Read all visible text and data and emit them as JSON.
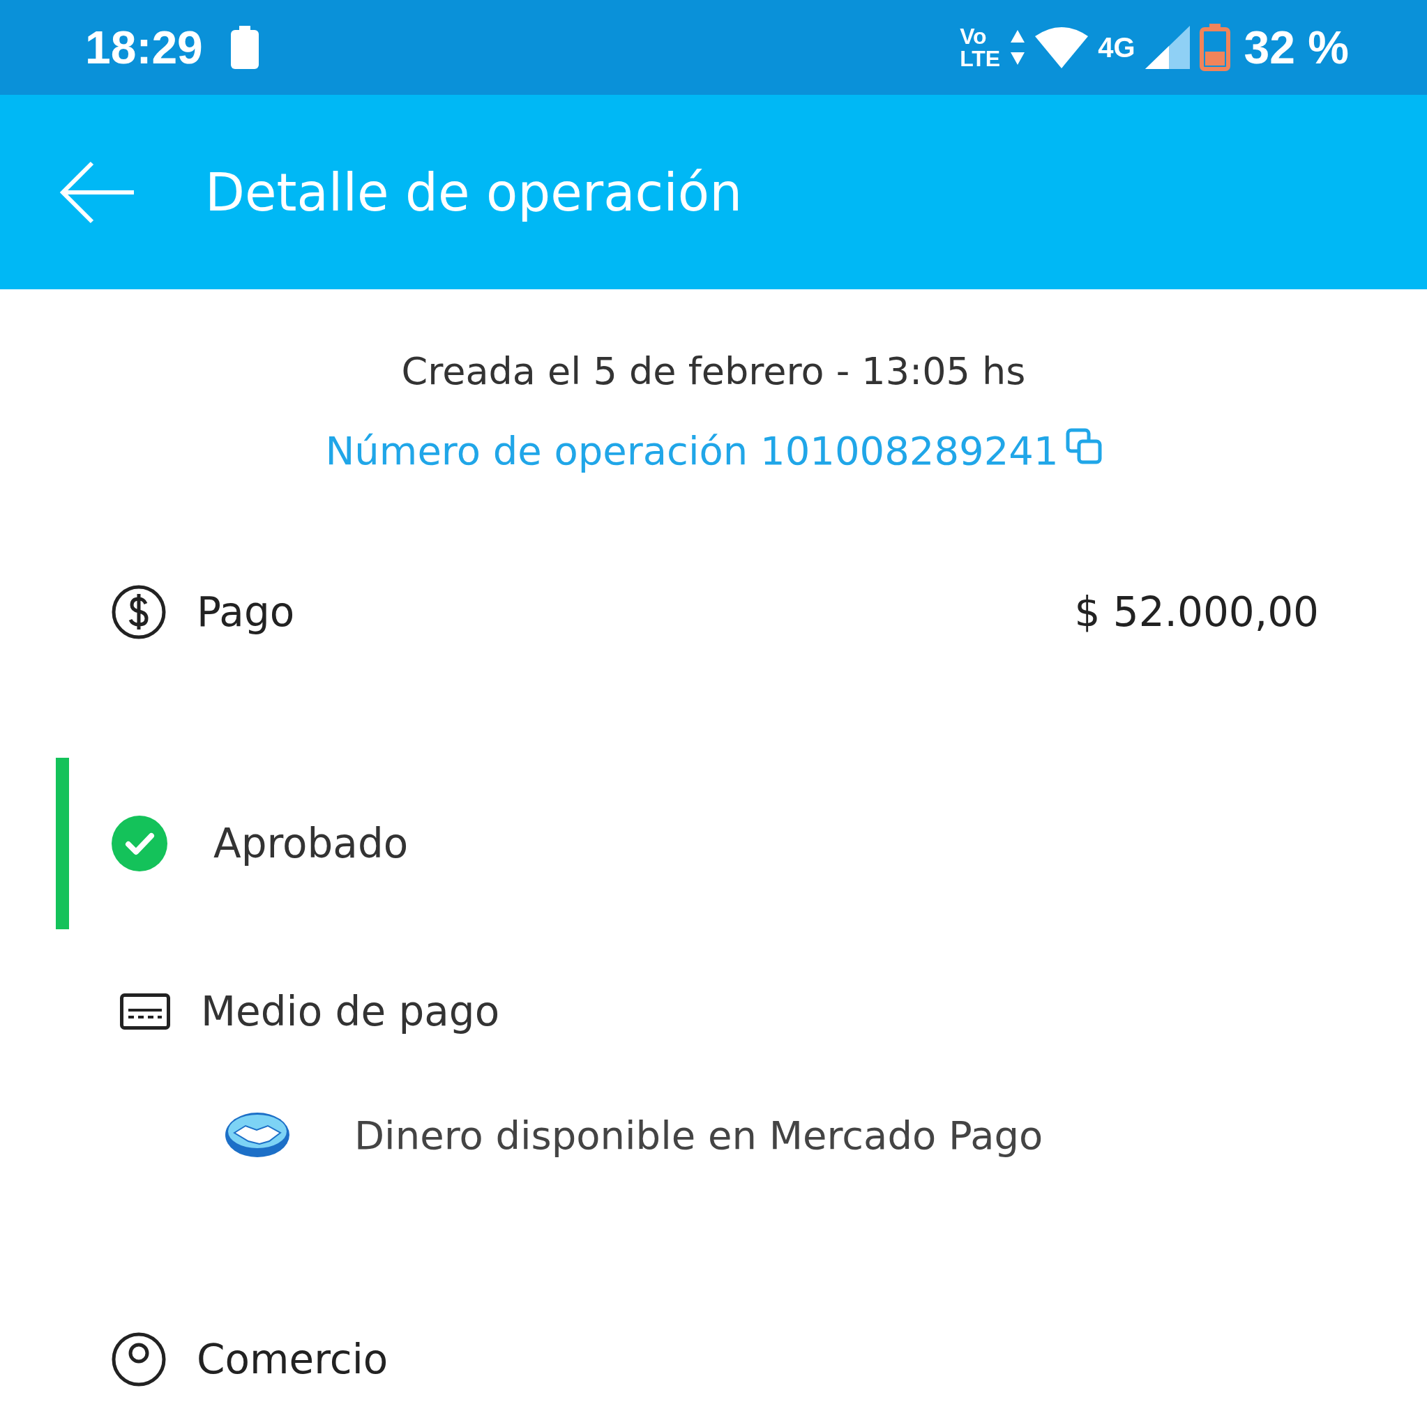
{
  "status_bar": {
    "time": "18:29",
    "volte_top": "Vo",
    "volte_bottom": "LTE",
    "network": "4G",
    "battery": "32 %"
  },
  "app_bar": {
    "title": "Detalle de operación"
  },
  "created": "Creada el 5 de febrero - 13:05 hs",
  "operation_number": "Número de operación 101008289241",
  "payment": {
    "label": "Pago",
    "amount": "$ 52.000,00"
  },
  "status": {
    "label": "Aprobado",
    "approved": true
  },
  "payment_method": {
    "label": "Medio de pago",
    "detail": "Dinero disponible en Mercado Pago"
  },
  "merchant": {
    "label": "Comercio"
  }
}
